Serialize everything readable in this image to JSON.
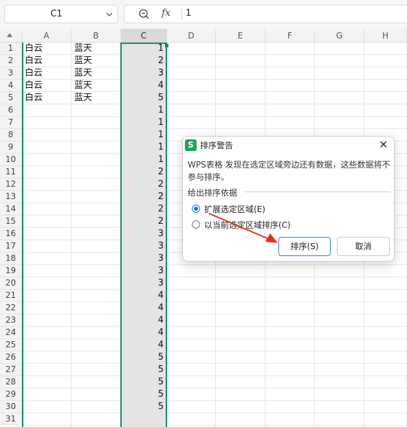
{
  "formula_bar": {
    "name_box": "C1",
    "fx_label": "fx",
    "value": "1"
  },
  "columns": [
    "A",
    "B",
    "C",
    "D",
    "E",
    "F",
    "G",
    "H"
  ],
  "selected_column": "C",
  "rows": [
    "1",
    "2",
    "3",
    "4",
    "5",
    "6",
    "7",
    "8",
    "9",
    "10",
    "11",
    "12",
    "13",
    "14",
    "15",
    "16",
    "17",
    "18",
    "19",
    "20",
    "21",
    "22",
    "23",
    "24",
    "25",
    "26",
    "27",
    "28",
    "29",
    "30",
    "31"
  ],
  "cells": {
    "A": [
      "白云",
      "白云",
      "白云",
      "白云",
      "白云"
    ],
    "B": [
      "蓝天",
      "蓝天",
      "蓝天",
      "蓝天",
      "蓝天"
    ],
    "C": [
      "1",
      "2",
      "3",
      "4",
      "5",
      "1",
      "1",
      "1",
      "1",
      "1",
      "2",
      "2",
      "2",
      "2",
      "2",
      "3",
      "3",
      "3",
      "3",
      "3",
      "4",
      "4",
      "4",
      "4",
      "4",
      "5",
      "5",
      "5",
      "5",
      "5"
    ]
  },
  "dialog": {
    "logo": "S",
    "title": "排序警告",
    "close": "✕",
    "message": "WPS表格 发现在选定区域旁边还有数据，这些数据将不参与排序。",
    "group_label": "给出排序依据",
    "option_expand": "扩展选定区域(E)",
    "option_current": "以当前选定区域排序(C)",
    "sort_button": "排序(S)",
    "cancel_button": "取消"
  },
  "colors": {
    "selection": "#1a8a5a",
    "annotation_arrow": "#e03020",
    "primary_border": "#2f7ed8"
  }
}
